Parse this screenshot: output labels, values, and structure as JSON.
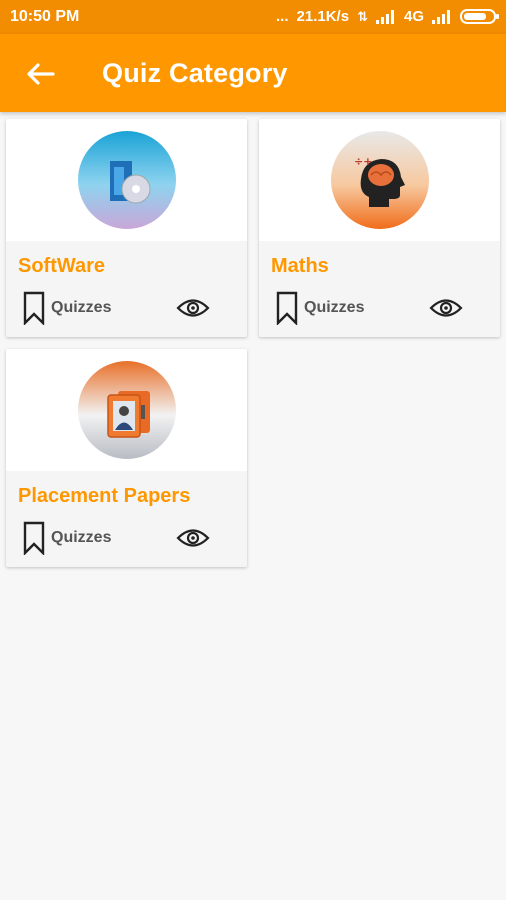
{
  "status_bar": {
    "time": "10:50 PM",
    "dots": "...",
    "speed": "21.1K/s",
    "network": "4G",
    "battery_level": 0.8
  },
  "app_bar": {
    "back_icon": "arrow-left-icon",
    "title": "Quiz Category"
  },
  "categories": [
    {
      "name": "SoftWare",
      "subtitle": "Quizzes",
      "image": "software-box-cd-icon"
    },
    {
      "name": "Maths",
      "subtitle": "Quizzes",
      "image": "brain-head-icon"
    },
    {
      "name": "Placement Papers",
      "subtitle": "Quizzes",
      "image": "id-card-person-icon"
    }
  ],
  "colors": {
    "primary": "#ff9800",
    "status_bar": "#f28c00",
    "background": "#f7f7f7",
    "category_text": "#ff9800"
  }
}
